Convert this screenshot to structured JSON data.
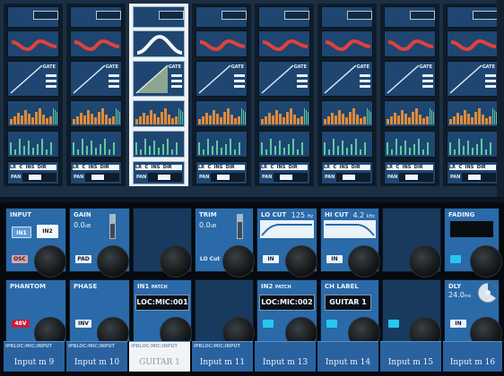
{
  "colors": {
    "panel_blue": "#2a6aa8",
    "panel_dark": "#173a5e",
    "overview_bg": "#1a2f44",
    "strip_selected": "#eef3f7",
    "eq_curve": "#e0413c",
    "meter_bar": "#e08a3a",
    "meter_green": "#5ec8a0",
    "switch_on": "#eaf2fa",
    "switch_cyan": "#27c8f0",
    "osc_red": "#e07070",
    "phantom_red": "#c81e3c"
  },
  "overview": {
    "selected_index": 2,
    "strips": [
      {
        "gate_label": "GATE",
        "ped_labels": "LR  C  INS  DIR",
        "pan_label": "PAN",
        "pan_position": 0.3
      },
      {
        "gate_label": "GATE",
        "ped_labels": "LR  C  INS  DIR",
        "pan_label": "PAN",
        "pan_position": 0.3
      },
      {
        "gate_label": "GATE",
        "ped_labels": "LR  C  INS  DIR",
        "pan_label": "PAN",
        "pan_position": 0.5
      },
      {
        "gate_label": "GATE",
        "ped_labels": "LR  C  INS  DIR",
        "pan_label": "PAN",
        "pan_position": 0.3
      },
      {
        "gate_label": "GATE",
        "ped_labels": "LR  C  INS  DIR",
        "pan_label": "PAN",
        "pan_position": 0.3
      },
      {
        "gate_label": "GATE",
        "ped_labels": "LR  C  INS  DIR",
        "pan_label": "PAN",
        "pan_position": 0.3
      },
      {
        "gate_label": "GATE",
        "ped_labels": "LR  C  INS  DIR",
        "pan_label": "PAN",
        "pan_position": 0.3
      },
      {
        "gate_label": "GATE",
        "ped_labels": "LR  C  INS  DIR",
        "pan_label": "PAN",
        "pan_position": 0.3
      }
    ]
  },
  "controls": {
    "input": {
      "title": "INPUT",
      "in1": "IN1",
      "in2": "IN2",
      "osc": "OSC"
    },
    "gain": {
      "title": "GAIN",
      "value": "0.0",
      "unit": "dB",
      "pad": "PAD",
      "level": 0.6
    },
    "trim": {
      "title": "TRIM",
      "value": "0.0",
      "unit": "dB",
      "locut_btn": "LO Cut",
      "level": 0.7
    },
    "lo_cut": {
      "title": "LO CUT",
      "freq": "125",
      "unit": "Hz",
      "in_btn": "IN"
    },
    "hi_cut": {
      "title": "HI CUT",
      "freq": "4.2",
      "unit": "kHz",
      "in_btn": "IN"
    },
    "fading": {
      "title": "FADING"
    },
    "phantom": {
      "title": "PHANTOM",
      "btn": "48V"
    },
    "phase": {
      "title": "PHASE",
      "btn": "INV"
    },
    "in1_patch": {
      "title_a": "IN1",
      "title_b": "PATCH",
      "value": "LOC:MIC:001"
    },
    "in2_patch": {
      "title_a": "IN2",
      "title_b": "PATCH",
      "value": "LOC:MIC:002"
    },
    "ch_label": {
      "title": "CH LABEL",
      "value": "GUITAR 1"
    },
    "delay": {
      "title": "DLY",
      "value": "24.0",
      "unit": "ms",
      "in_btn": "IN"
    }
  },
  "channels": [
    {
      "small": "IPBLOC:MIC:INPUT",
      "name": "Input m 9"
    },
    {
      "small": "IPBLOC:MIC:INPUT",
      "name": "Input m 10"
    },
    {
      "small": "IPBLOC:MIC:INPUT",
      "name": "GUITAR 1",
      "selected": true
    },
    {
      "small": "IPBLOC:MIC:INPUT",
      "name": "Input m 11"
    },
    {
      "small": "",
      "name": "Input m 13"
    },
    {
      "small": "",
      "name": "Input m 14"
    },
    {
      "small": "",
      "name": "Input m 15"
    },
    {
      "small": "",
      "name": "Input m 16"
    }
  ]
}
